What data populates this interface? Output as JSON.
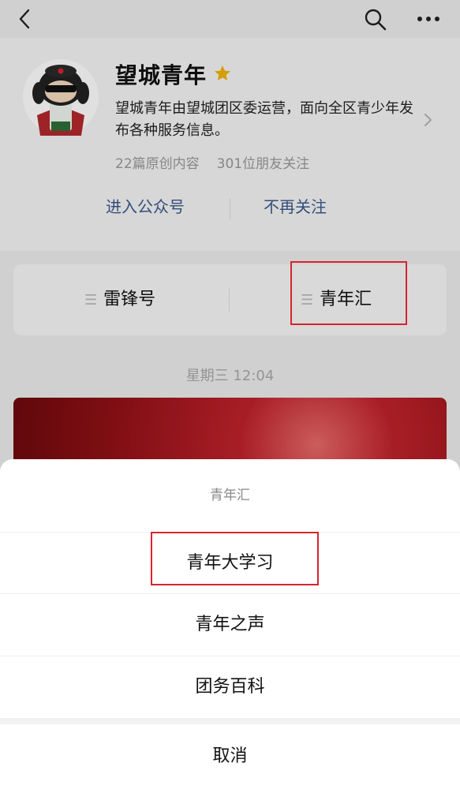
{
  "topbar": {
    "back_icon": "back-icon",
    "search_icon": "search-icon",
    "more_icon": "more-icon"
  },
  "profile": {
    "name": "望城青年",
    "verified_icon": "star-icon",
    "description": "望城青年由望城团区委运营，面向全区青少年发布各种服务信息。",
    "original_count": "22篇原创内容",
    "followers": "301位朋友关注",
    "enter_label": "进入公众号",
    "unfollow_label": "不再关注"
  },
  "menu": {
    "items": [
      {
        "label": "雷锋号"
      },
      {
        "label": "青年汇"
      }
    ]
  },
  "feed": {
    "timestamp": "星期三 12:04"
  },
  "sheet": {
    "title": "青年汇",
    "options": [
      {
        "label": "青年大学习"
      },
      {
        "label": "青年之声"
      },
      {
        "label": "团务百科"
      }
    ],
    "cancel_label": "取消"
  },
  "colors": {
    "accent_link": "#3b5a8c",
    "highlight_box": "#d9232f",
    "star": "#f2b400"
  }
}
